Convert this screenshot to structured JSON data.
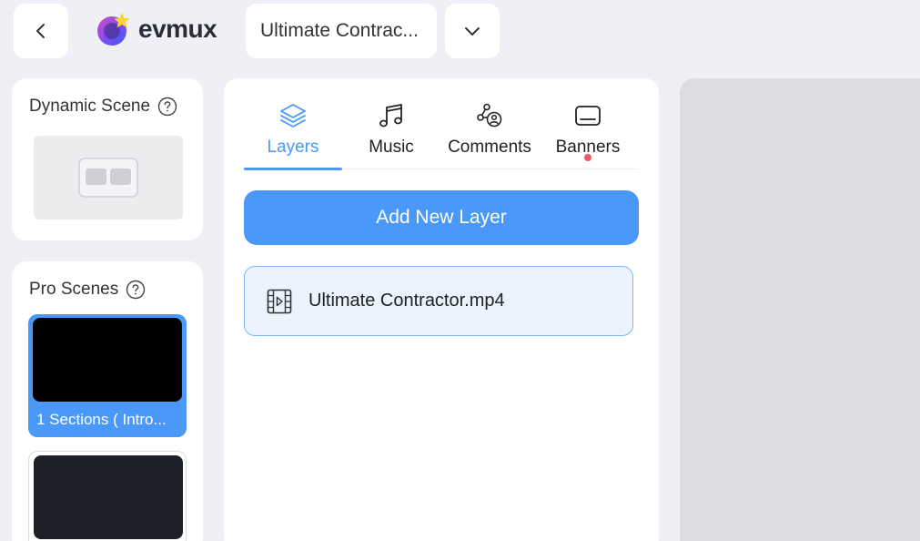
{
  "header": {
    "logo_text": "evmux",
    "project_name": "Ultimate Contrac..."
  },
  "left": {
    "dynamic_scene_title": "Dynamic Scene",
    "pro_scenes_title": "Pro Scenes",
    "scenes": [
      {
        "label": "1 Sections ( Intro..."
      }
    ]
  },
  "tabs": [
    {
      "label": "Layers"
    },
    {
      "label": "Music"
    },
    {
      "label": "Comments"
    },
    {
      "label": "Banners"
    }
  ],
  "layers": {
    "add_label": "Add New Layer",
    "items": [
      {
        "label": "Ultimate Contractor.mp4"
      }
    ]
  },
  "colors": {
    "accent": "#4a98f7",
    "notification_dot": "#f0576b",
    "background": "#eef0f5"
  }
}
